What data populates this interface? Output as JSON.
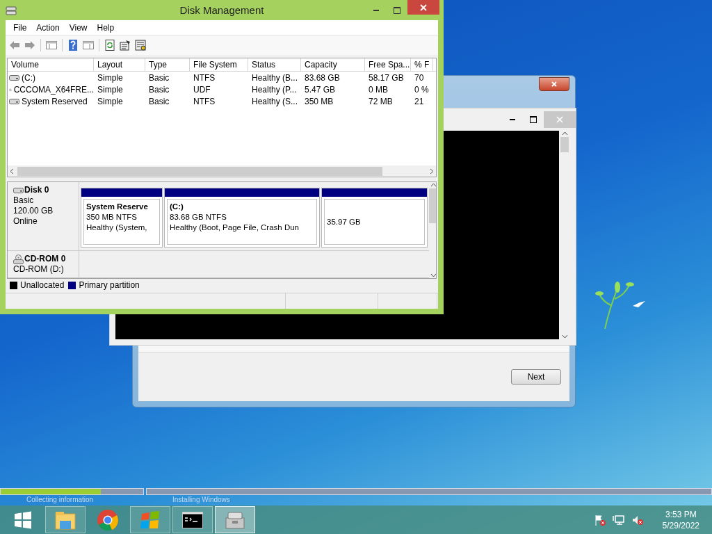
{
  "disk_management": {
    "title": "Disk Management",
    "menu": [
      "File",
      "Action",
      "View",
      "Help"
    ],
    "columns": [
      "Volume",
      "Layout",
      "Type",
      "File System",
      "Status",
      "Capacity",
      "Free Spa...",
      "% F"
    ],
    "rows": [
      {
        "kind": "disk",
        "cells": [
          "(C:)",
          "Simple",
          "Basic",
          "NTFS",
          "Healthy (B...",
          "83.68 GB",
          "58.17 GB",
          "70"
        ]
      },
      {
        "kind": "optical",
        "cells": [
          "CCCOMA_X64FRE...",
          "Simple",
          "Basic",
          "UDF",
          "Healthy (P...",
          "5.47 GB",
          "0 MB",
          "0 %"
        ]
      },
      {
        "kind": "disk",
        "cells": [
          "System Reserved",
          "Simple",
          "Basic",
          "NTFS",
          "Healthy (S...",
          "350 MB",
          "72 MB",
          "21"
        ]
      }
    ],
    "disks": [
      {
        "kind": "disk",
        "name": "Disk 0",
        "details": [
          "Basic",
          "120.00 GB",
          "Online"
        ],
        "partitions": [
          {
            "name": "System Reserve",
            "lines": [
              "350 MB NTFS",
              "Healthy (System,"
            ]
          },
          {
            "name": "(C:)",
            "lines": [
              "83.68 GB NTFS",
              "Healthy (Boot, Page File, Crash Dun"
            ]
          },
          {
            "lines": [
              "35.97 GB"
            ]
          }
        ]
      },
      {
        "kind": "optical",
        "name": "CD-ROM 0",
        "details": [
          "CD-ROM (D:)"
        ]
      }
    ],
    "legend": [
      {
        "label": "Unallocated",
        "color": "#000000"
      },
      {
        "label": "Primary partition",
        "color": "#000080"
      }
    ]
  },
  "setup": {
    "next_button": "Next"
  },
  "progress": {
    "steps": [
      {
        "label": "Collecting information",
        "level": 0.7
      },
      {
        "label": "Installing Windows",
        "level": 0
      }
    ]
  },
  "taskbar": {
    "apps": [
      {
        "kind": "explorer",
        "running": true,
        "selected": false
      },
      {
        "kind": "chrome",
        "running": false,
        "selected": false
      },
      {
        "kind": "setup",
        "running": true,
        "selected": false
      },
      {
        "kind": "cmd",
        "running": true,
        "selected": false
      },
      {
        "kind": "diskmgmt",
        "running": true,
        "selected": true
      }
    ],
    "time": "3:53 PM",
    "date": "5/29/2022"
  }
}
